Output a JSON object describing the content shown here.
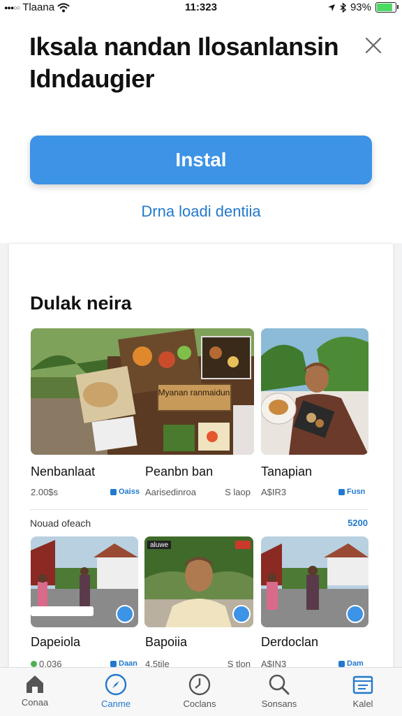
{
  "status_bar": {
    "carrier": "Tlaana",
    "time": "11:323",
    "battery": "93%"
  },
  "header": {
    "title": "Iksala nandan Ilosanlansin Idndaugier",
    "install_label": "Instal",
    "secondary_link": "Drna loadi dentiia"
  },
  "section": {
    "title": "Dulak neira",
    "row1": [
      {
        "name": "Nenbanlaat",
        "meta": "2.00$s",
        "badge": "Oaiss"
      },
      {
        "name": "Peanbn ban",
        "meta": "Aarisedinroa",
        "meta_right": "S laop"
      },
      {
        "name": "Tanapian",
        "meta": "A$IR3",
        "badge": "Fusn"
      }
    ],
    "subheading": "Nouad ofeach",
    "subheading_right": "5200",
    "row2": [
      {
        "name": "Dapeiola",
        "meta": "0.036",
        "badge": "Daan"
      },
      {
        "name": "Bapoiia",
        "meta": "4.5tile",
        "meta_right": "S tlon"
      },
      {
        "name": "Derdoclan",
        "meta": "A$IN3",
        "badge": "Dam"
      }
    ],
    "image_caption": "Myanan ranmaidun",
    "tag_right": "aluwe"
  },
  "tabs": [
    {
      "label": "Conaa",
      "icon": "home-icon"
    },
    {
      "label": "Canme",
      "icon": "compass-icon"
    },
    {
      "label": "Coclans",
      "icon": "clock-icon"
    },
    {
      "label": "Sonsans",
      "icon": "search-icon"
    },
    {
      "label": "Kalel",
      "icon": "folder-icon"
    }
  ],
  "colors": {
    "accent": "#3d93e6",
    "link": "#2279cc"
  }
}
